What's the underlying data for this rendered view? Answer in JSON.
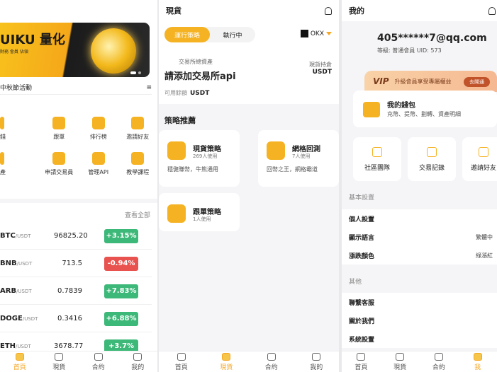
{
  "screen1": {
    "banner": {
      "title": "UIKU 量化",
      "subtitle": "財務 會員 佔領"
    },
    "notice": {
      "text": "中秋節活動",
      "menu_icon": "menu-icon"
    },
    "grid": [
      {
        "label": "錢",
        "icon": "wallet-icon"
      },
      {
        "label": "跟單",
        "icon": "document-icon"
      },
      {
        "label": "排行榜",
        "icon": "trophy-icon"
      },
      {
        "label": "邀請好友",
        "icon": "add-user-icon"
      },
      {
        "label": "產",
        "icon": "asset-icon"
      },
      {
        "label": "申請交易員",
        "icon": "person-icon"
      },
      {
        "label": "管理API",
        "icon": "api-icon"
      },
      {
        "label": "教學課程",
        "icon": "course-icon"
      }
    ],
    "view_all": "查看全部",
    "market": [
      {
        "symbol": "BTC",
        "quote": "/USDT",
        "price": "96825.20",
        "change": "+3.15%",
        "dir": "up"
      },
      {
        "symbol": "BNB",
        "quote": "/USDT",
        "price": "713.5",
        "change": "-0.94%",
        "dir": "down"
      },
      {
        "symbol": "ARB",
        "quote": "/USDT",
        "price": "0.7839",
        "change": "+7.83%",
        "dir": "up"
      },
      {
        "symbol": "DOGE",
        "quote": "/USDT",
        "price": "0.3416",
        "change": "+6.88%",
        "dir": "up"
      },
      {
        "symbol": "ETH",
        "quote": "/USDT",
        "price": "3678.77",
        "change": "+3.7%",
        "dir": "up"
      }
    ],
    "tabs": [
      "首頁",
      "現貨",
      "合約",
      "我的"
    ]
  },
  "screen2": {
    "title": "現貨",
    "segments": [
      "運行策略",
      "執行中"
    ],
    "exchange": "OKX",
    "assets_label": "交易所總資產",
    "assets_value": "請添加交易所api",
    "holding_label": "現貨持倉",
    "holding_unit": "USDT",
    "available_label": "可用餘額",
    "available_unit": "USDT",
    "section_title": "策略推薦",
    "strategies": [
      {
        "title": "現貨策略",
        "users": "269人使用",
        "desc": "穩健賺幣，牛熊通用"
      },
      {
        "title": "網格回測",
        "users": "7人使用",
        "desc": "回幣之王，網格霸道"
      },
      {
        "title": "跟單策略",
        "users": "1人使用",
        "desc": ""
      }
    ],
    "tabs": [
      "首頁",
      "現貨",
      "合約",
      "我的"
    ]
  },
  "screen3": {
    "title": "我的",
    "email": "405******7@qq.com",
    "level": "等級: 普通會員   UID: 573",
    "vip": {
      "badge": "VIP",
      "text": "升級會員享受專屬權益",
      "button": "去開通"
    },
    "wallet": {
      "title": "我的錢包",
      "subtitle": "充幣、提幣、劃轉、資產明細"
    },
    "quick": [
      "社區團隊",
      "交易記錄",
      "邀請好友"
    ],
    "basic_label": "基本設置",
    "basic": [
      {
        "label": "個人設置",
        "value": ""
      },
      {
        "label": "顯示語言",
        "value": "繁體中"
      },
      {
        "label": "漲跌顏色",
        "value": "綠漲紅"
      }
    ],
    "other_label": "其他",
    "other": [
      {
        "label": "聯繫客服"
      },
      {
        "label": "關於我們"
      },
      {
        "label": "系統設置"
      }
    ],
    "tabs": [
      "首頁",
      "現貨",
      "合約",
      "我"
    ]
  }
}
